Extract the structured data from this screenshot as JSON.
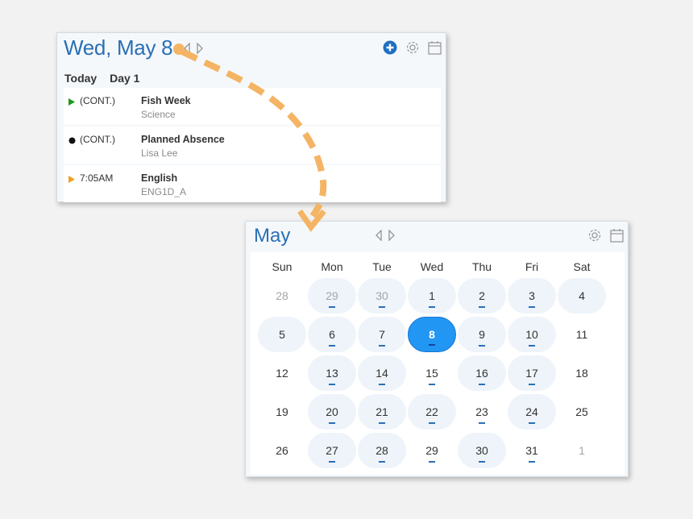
{
  "day_panel": {
    "title": "Wed, May 8",
    "today_label": "Today",
    "day_label": "Day 1",
    "events": [
      {
        "marker": "green-triangle",
        "marker_color": "#1a9a1a",
        "time": "(CONT.)",
        "title": "Fish Week",
        "subtitle": "Science"
      },
      {
        "marker": "black-dot",
        "marker_color": "#111111",
        "time": "(CONT.)",
        "title": "Planned Absence",
        "subtitle": "Lisa Lee"
      },
      {
        "marker": "orange-triangle",
        "marker_color": "#f0a020",
        "time": "7:05AM",
        "title": "English",
        "subtitle": "ENG1D_A"
      }
    ]
  },
  "month_panel": {
    "title": "May",
    "weekdays": [
      "Sun",
      "Mon",
      "Tue",
      "Wed",
      "Thu",
      "Fri",
      "Sat"
    ],
    "weeks": [
      [
        {
          "d": "28",
          "muted": true,
          "shaded": false,
          "dot": false
        },
        {
          "d": "29",
          "muted": true,
          "shaded": true,
          "dot": true
        },
        {
          "d": "30",
          "muted": true,
          "shaded": true,
          "dot": true
        },
        {
          "d": "1",
          "muted": false,
          "shaded": true,
          "dot": true
        },
        {
          "d": "2",
          "muted": false,
          "shaded": true,
          "dot": true
        },
        {
          "d": "3",
          "muted": false,
          "shaded": true,
          "dot": true
        },
        {
          "d": "4",
          "muted": false,
          "shaded": true,
          "dot": false
        }
      ],
      [
        {
          "d": "5",
          "muted": false,
          "shaded": true,
          "dot": false
        },
        {
          "d": "6",
          "muted": false,
          "shaded": true,
          "dot": true
        },
        {
          "d": "7",
          "muted": false,
          "shaded": true,
          "dot": true
        },
        {
          "d": "8",
          "muted": false,
          "shaded": false,
          "dot": true,
          "selected": true
        },
        {
          "d": "9",
          "muted": false,
          "shaded": true,
          "dot": true
        },
        {
          "d": "10",
          "muted": false,
          "shaded": true,
          "dot": true
        },
        {
          "d": "11",
          "muted": false,
          "shaded": false,
          "dot": false
        }
      ],
      [
        {
          "d": "12",
          "muted": false,
          "shaded": false,
          "dot": false
        },
        {
          "d": "13",
          "muted": false,
          "shaded": true,
          "dot": true
        },
        {
          "d": "14",
          "muted": false,
          "shaded": true,
          "dot": true
        },
        {
          "d": "15",
          "muted": false,
          "shaded": false,
          "dot": true
        },
        {
          "d": "16",
          "muted": false,
          "shaded": true,
          "dot": true
        },
        {
          "d": "17",
          "muted": false,
          "shaded": true,
          "dot": true
        },
        {
          "d": "18",
          "muted": false,
          "shaded": false,
          "dot": false
        }
      ],
      [
        {
          "d": "19",
          "muted": false,
          "shaded": false,
          "dot": false
        },
        {
          "d": "20",
          "muted": false,
          "shaded": true,
          "dot": true
        },
        {
          "d": "21",
          "muted": false,
          "shaded": true,
          "dot": true
        },
        {
          "d": "22",
          "muted": false,
          "shaded": true,
          "dot": true
        },
        {
          "d": "23",
          "muted": false,
          "shaded": false,
          "dot": true
        },
        {
          "d": "24",
          "muted": false,
          "shaded": true,
          "dot": true
        },
        {
          "d": "25",
          "muted": false,
          "shaded": false,
          "dot": false
        }
      ],
      [
        {
          "d": "26",
          "muted": false,
          "shaded": false,
          "dot": false
        },
        {
          "d": "27",
          "muted": false,
          "shaded": true,
          "dot": true
        },
        {
          "d": "28",
          "muted": false,
          "shaded": true,
          "dot": true
        },
        {
          "d": "29",
          "muted": false,
          "shaded": false,
          "dot": true
        },
        {
          "d": "30",
          "muted": false,
          "shaded": true,
          "dot": true
        },
        {
          "d": "31",
          "muted": false,
          "shaded": false,
          "dot": true
        },
        {
          "d": "1",
          "muted": true,
          "shaded": false,
          "dot": false
        }
      ]
    ]
  },
  "icons": {
    "add": "plus-circle-icon",
    "settings": "gear-icon",
    "calendar": "calendar-icon",
    "prev": "chevron-left-icon",
    "next": "chevron-right-icon"
  },
  "colors": {
    "accent": "#2a6fb5",
    "selected_day": "#2196f3",
    "arrow": "#f4b463"
  }
}
